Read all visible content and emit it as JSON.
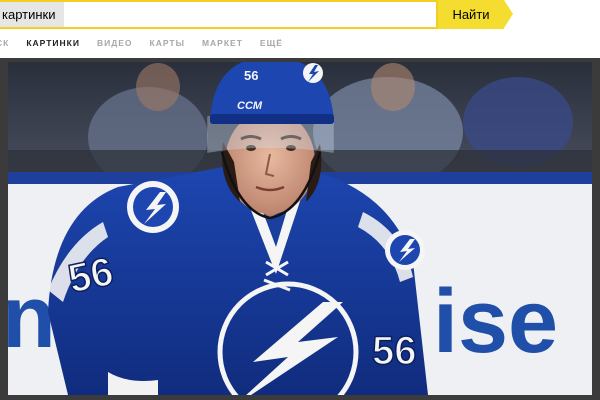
{
  "search": {
    "query": "картинки",
    "button_label": "Найти"
  },
  "tabs": [
    {
      "label": "ск",
      "active": false
    },
    {
      "label": "Картинки",
      "active": true
    },
    {
      "label": "Видео",
      "active": false
    },
    {
      "label": "Карты",
      "active": false
    },
    {
      "label": "Маркет",
      "active": false
    },
    {
      "label": "Ещё",
      "active": false
    }
  ],
  "photo": {
    "helmet_number": "56",
    "helmet_brand": "CCM",
    "sleeve_number": "56",
    "chest_number": "56",
    "board_text": "ise",
    "board_text_left": "ng"
  },
  "colors": {
    "accent": "#f5dd2f",
    "viewer_bg": "#3b3b3b",
    "jersey_blue": "#1a3fa3",
    "board_blue": "#1f4fa8"
  }
}
